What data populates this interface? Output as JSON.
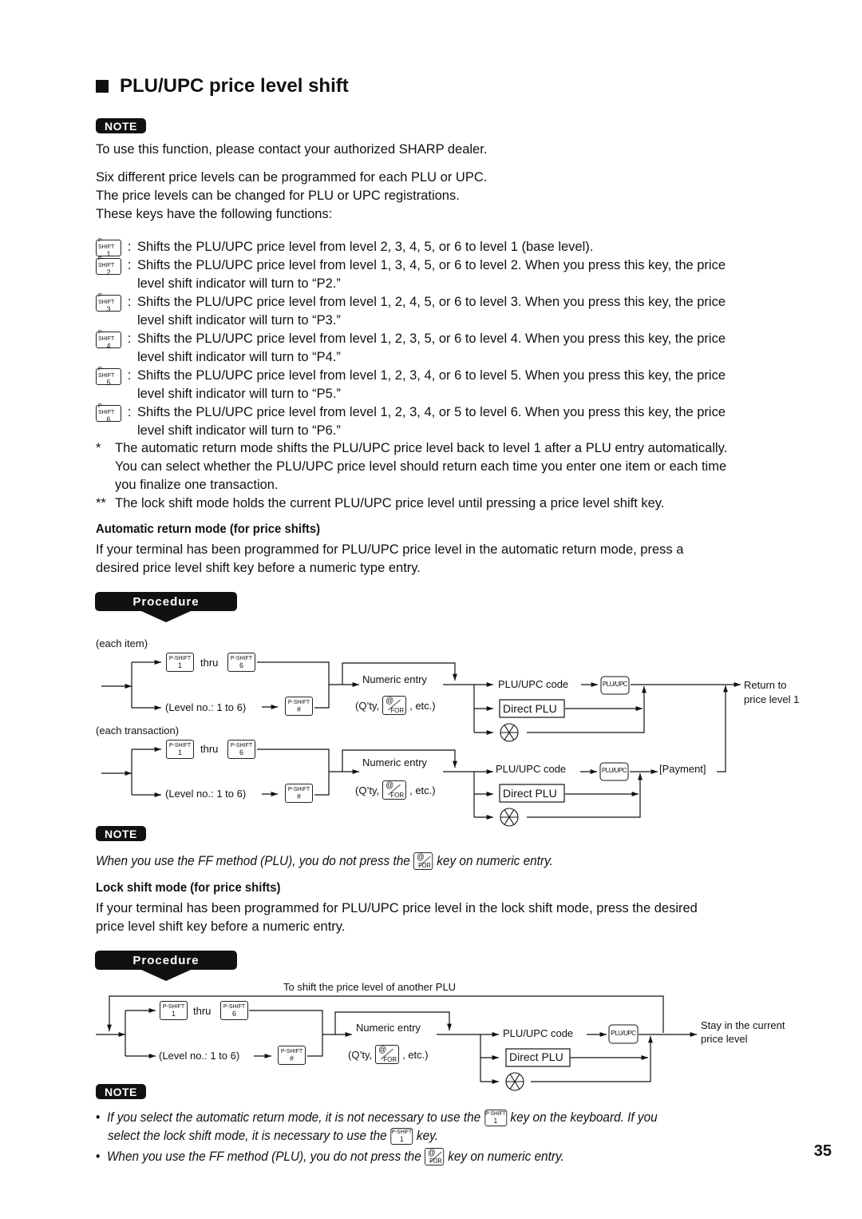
{
  "page": {
    "title": "PLU/UPC price level shift",
    "note_label": "NOTE",
    "procedure_label": "Procedure",
    "page_number": "35"
  },
  "intro": {
    "note_text": "To use this function, please contact your authorized SHARP dealer.",
    "lines": [
      "Six different price levels can be programmed for each PLU or UPC.",
      "The price levels can be changed for PLU or UPC registrations.",
      "These keys have the following functions:"
    ]
  },
  "keys": {
    "pshift_top": "P-SHIFT",
    "items": [
      {
        "num": "1",
        "text": "Shifts the PLU/UPC price level from level 2, 3, 4, 5, or 6 to level 1 (base level).",
        "text2": ""
      },
      {
        "num": "2",
        "text": "Shifts the PLU/UPC price level from level 1, 3, 4, 5, or 6 to level 2.  When you press this key, the price",
        "text2": "level shift indicator will turn to “P2.”"
      },
      {
        "num": "3",
        "text": "Shifts the PLU/UPC price level from level 1, 2, 4, 5, or 6 to level 3.  When you press this key, the price",
        "text2": "level shift indicator will turn to “P3.”"
      },
      {
        "num": "4",
        "text": "Shifts the PLU/UPC price level from level 1, 2, 3, 5, or 6 to level 4.  When you press this key, the price",
        "text2": "level shift indicator will turn to “P4.”"
      },
      {
        "num": "5",
        "text": "Shifts the PLU/UPC price level from level 1, 2, 3, 4, or 6 to level 5.  When you press this key, the price",
        "text2": "level shift indicator will turn to “P5.”"
      },
      {
        "num": "6",
        "text": "Shifts the PLU/UPC price level from level 1, 2, 3, 4, or 5 to level 6.  When you press this key, the price",
        "text2": "level shift indicator will turn to “P6.”"
      }
    ]
  },
  "footnotes": [
    {
      "mark": "*",
      "lines": [
        "The automatic return mode shifts the PLU/UPC price level back to level 1 after a PLU entry automatically.",
        "You can select whether the PLU/UPC price level should return each time you enter one item or each time",
        "you finalize one transaction."
      ]
    },
    {
      "mark": "**",
      "lines": [
        "The lock shift mode holds the current PLU/UPC price level until pressing a price level shift key."
      ]
    }
  ],
  "auto_section": {
    "heading": "Automatic return mode (for price shifts)",
    "lines": [
      "If your terminal has been programmed for PLU/UPC price level in the automatic return mode, press a",
      "desired price level shift key before a numeric type entry."
    ],
    "note_text_before": "When you use the FF method (PLU), you do not press the",
    "note_text_after": "key on numeric entry."
  },
  "lock_section": {
    "heading": "Lock shift mode (for price shifts)",
    "lines": [
      "If your terminal has been programmed for PLU/UPC price level in the lock shift mode, press the desired",
      "price level shift key before a numeric entry."
    ]
  },
  "diagram": {
    "each_item": "(each item)",
    "each_transaction": "(each transaction)",
    "thru": "thru",
    "level_no": "(Level no.: 1 to 6)",
    "numeric_entry": "Numeric entry",
    "qty_before": "(Q’ty,",
    "qty_after": ", etc.)",
    "plu_upc_code": "PLU/UPC code",
    "plu_upc_key": "PLU/UPC",
    "direct_plu": "Direct PLU",
    "payment": "[Payment]",
    "return_to_1": "Return to",
    "return_to_2": "price level 1",
    "another_plu": "To shift the price level of another PLU",
    "stay_1": "Stay in the current",
    "stay_2": "price level",
    "key_at": "@",
    "key_for": "FOR",
    "key_hash": "#",
    "key_1": "1",
    "key_6": "6"
  },
  "bottom_notes": {
    "b1_part1": "If you select the automatic return mode, it is not necessary to use the",
    "b1_part2": "key on the keyboard.  If you",
    "b1_part3": "select the lock shift mode, it is necessary to use the",
    "b1_part4": "key.",
    "b2_part1": "When you use the FF method (PLU), you do not press the",
    "b2_part2": "key on numeric entry.",
    "bullet": "•"
  }
}
